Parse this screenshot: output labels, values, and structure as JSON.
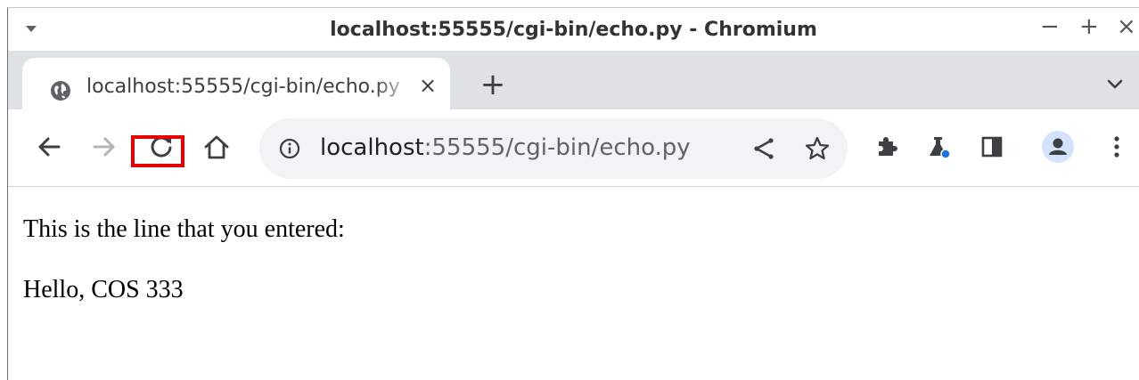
{
  "window": {
    "title": "localhost:55555/cgi-bin/echo.py - Chromium",
    "controls": {
      "minimize": "−",
      "maximize": "+",
      "close": "×"
    }
  },
  "tabs": [
    {
      "title": "localhost:55555/cgi-bin/echo.py",
      "icon": "globe-icon",
      "close": "×"
    }
  ],
  "tabstrip": {
    "new_tab": "+"
  },
  "toolbar": {
    "highlighted_button": "reload",
    "highlight_color": "#e60000"
  },
  "omnibox": {
    "url_host": "localhost",
    "url_rest": ":55555/cgi-bin/echo.py"
  },
  "page": {
    "line1": "This is the line that you entered:",
    "line2": "Hello, COS 333"
  },
  "colors": {
    "tabstrip_bg": "#dee1e6",
    "omnibox_bg": "#f1f3f4",
    "profile_bg": "#d3e3fd",
    "labs_dot": "#1a73e8"
  }
}
